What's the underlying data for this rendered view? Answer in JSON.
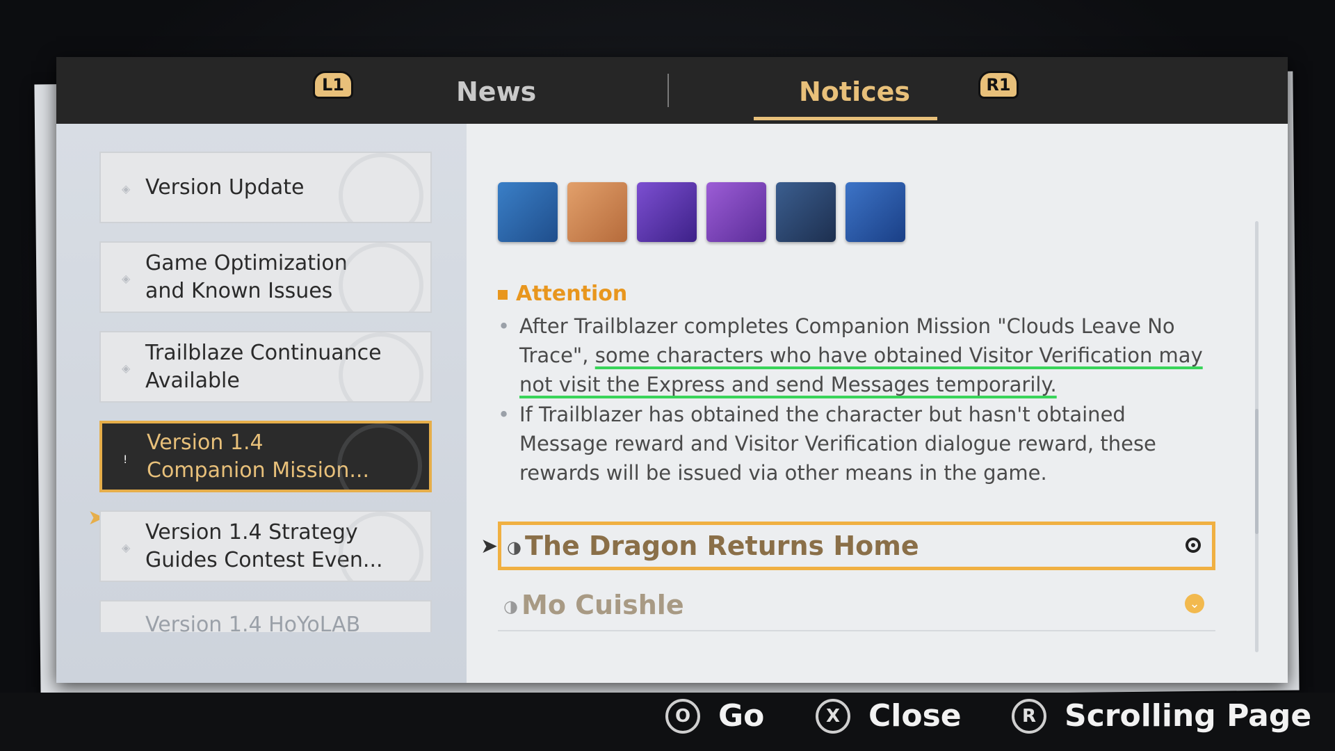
{
  "tabs": {
    "left_shoulder": "L1",
    "news": "News",
    "notices": "Notices",
    "right_shoulder": "R1"
  },
  "sidebar": {
    "items": [
      {
        "label": "Version Update"
      },
      {
        "label": "Game Optimization and Known Issues"
      },
      {
        "label": "Trailblaze Continuance Available"
      },
      {
        "label": "Version 1.4 Companion Mission..."
      },
      {
        "label": "Version 1.4 Strategy Guides Contest Even..."
      },
      {
        "label": "Version 1.4 HoYoLAB"
      }
    ],
    "active_index": 3
  },
  "content": {
    "reward_icons": [
      "book-icon",
      "crystal-icon",
      "purple-book-icon",
      "gold-crystal-icon",
      "sword-icon",
      "card-icon"
    ],
    "attention_title": "Attention",
    "bullet1_part1": "After Trailblazer completes Companion Mission \"Clouds Leave No Trace\", ",
    "bullet1_highlight": "some characters who have obtained Visitor Verification may not visit the Express and send Messages temporarily.",
    "bullet2": "If Trailblazer has obtained the character but hasn't obtained Message reward and Visitor Verification dialogue reward, these rewards will be issued via other means in the game.",
    "sections": [
      {
        "label": "The Dragon Returns Home"
      },
      {
        "label": "Mo Cuishle"
      }
    ]
  },
  "footer": {
    "go_button": "O",
    "go_label": "Go",
    "close_button": "X",
    "close_label": "Close",
    "scroll_button": "R",
    "scroll_label": "Scrolling Page"
  },
  "colors": {
    "accent_gold": "#e8c07a",
    "selection_orange": "#f0b042",
    "attention_orange": "#e8961e",
    "underline_green": "#39d45a"
  }
}
